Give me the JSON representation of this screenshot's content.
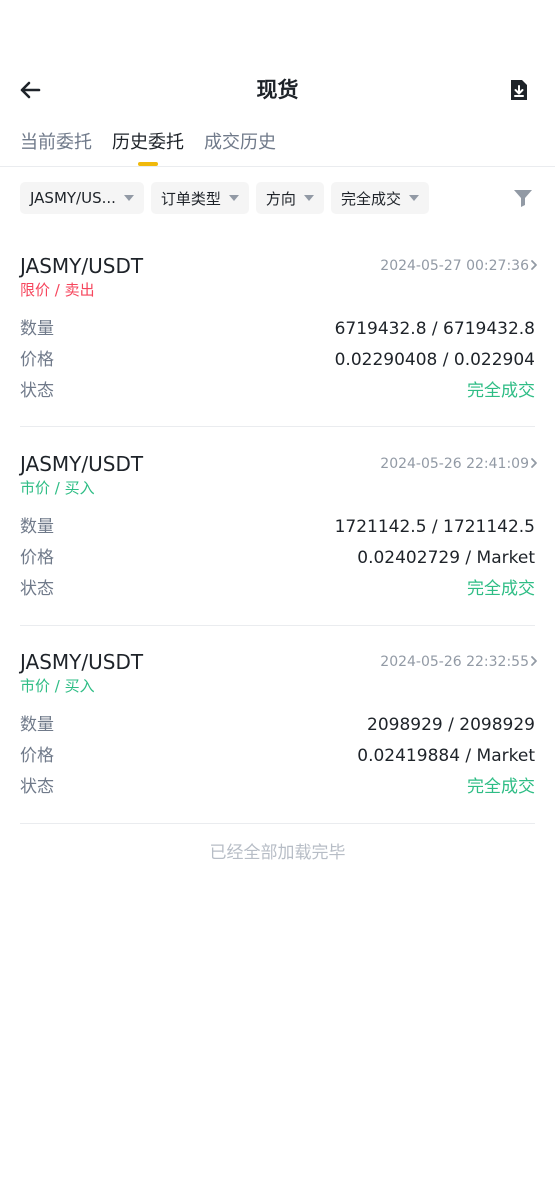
{
  "header": {
    "title": "现货",
    "back_icon": "arrow-left-icon",
    "download_icon": "download-icon"
  },
  "tabs": [
    {
      "label": "当前委托",
      "active": false
    },
    {
      "label": "历史委托",
      "active": true
    },
    {
      "label": "成交历史",
      "active": false
    }
  ],
  "filters": {
    "pair": "JASMY/US...",
    "order_type": "订单类型",
    "direction": "方向",
    "status": "完全成交",
    "filter_icon": "funnel-icon"
  },
  "labels": {
    "quantity": "数量",
    "price": "价格",
    "status": "状态"
  },
  "orders": [
    {
      "pair": "JASMY/USDT",
      "side": "限价 / 卖出",
      "time": "2024-05-27 00:27:36",
      "quantity": "6719432.8 / 6719432.8",
      "price": "0.02290408 / 0.022904",
      "status": "完全成交"
    },
    {
      "pair": "JASMY/USDT",
      "side": "市价 / 买入",
      "time": "2024-05-26 22:41:09",
      "quantity": "1721142.5 / 1721142.5",
      "price": "0.02402729 / Market",
      "status": "完全成交"
    },
    {
      "pair": "JASMY/USDT",
      "side": "市价 / 买入",
      "time": "2024-05-26 22:32:55",
      "quantity": "2098929 / 2098929",
      "price": "0.02419884 / Market",
      "status": "完全成交"
    }
  ],
  "footer": "已经全部加载完毕",
  "colors": {
    "accent": "#f0b90b",
    "sell": "#f6465d",
    "buy": "#2ebd85"
  }
}
